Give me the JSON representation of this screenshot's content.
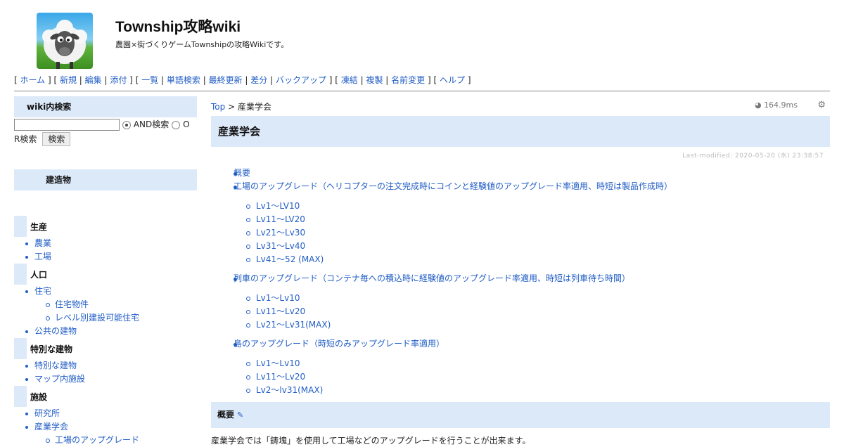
{
  "header": {
    "title": "Township攻略wiki",
    "subtitle": "農園×街づくりゲームTownshipの攻略Wikiです。"
  },
  "toolbar": {
    "groups": [
      [
        "ホーム"
      ],
      [
        "新規",
        "編集",
        "添付"
      ],
      [
        "一覧",
        "単語検索",
        "最終更新",
        "差分",
        "バックアップ"
      ],
      [
        "凍結",
        "複製",
        "名前変更"
      ],
      [
        "ヘルプ"
      ]
    ]
  },
  "sidebar": {
    "search": {
      "heading": "wiki内検索",
      "input_value": "",
      "and_label": "AND検索",
      "or_label_1": "O",
      "or_label_2": "R検索",
      "button_label": "検索"
    },
    "build_heading": "建造物",
    "categories": [
      {
        "name": "生産",
        "items": [
          {
            "label": "農業",
            "level": 1
          },
          {
            "label": "工場",
            "level": 1
          }
        ]
      },
      {
        "name": "人口",
        "items": [
          {
            "label": "住宅",
            "level": 1
          },
          {
            "label": "住宅物件",
            "level": 2
          },
          {
            "label": "レベル別建設可能住宅",
            "level": 2
          },
          {
            "label": "公共の建物",
            "level": 1
          }
        ]
      },
      {
        "name": "特別な建物",
        "items": [
          {
            "label": "特別な建物",
            "level": 1
          },
          {
            "label": "マップ内施設",
            "level": 1
          }
        ]
      },
      {
        "name": "施設",
        "items": [
          {
            "label": "研究所",
            "level": 1
          },
          {
            "label": "産業学会",
            "level": 1
          },
          {
            "label": "工場のアップグレード",
            "level": 2
          }
        ]
      }
    ]
  },
  "main": {
    "breadcrumb_link": "Top",
    "breadcrumb_sep": ">",
    "breadcrumb_current": "産業学会",
    "perf": "164.9ms",
    "page_title": "産業学会",
    "last_modified": "Last-modified: 2020-05-20 (水) 23:38:57",
    "toc": [
      {
        "label": "概要",
        "children": []
      },
      {
        "label": "工場のアップグレード（ヘリコプターの注文完成時にコインと経験値のアップグレード率適用、時短は製品作成時）",
        "children": [
          "Lv1～LV10",
          "Lv11～LV20",
          "Lv21～Lv30",
          "Lv31～Lv40",
          "Lv41～52 (MAX)"
        ]
      },
      {
        "label": "列車のアップグレード（コンテナ毎への積込時に経験値のアップグレード率適用、時短は列車待ち時間）",
        "children": [
          "Lv1～Lv10",
          "Lv11～Lv20",
          "Lv21～Lv31(MAX)"
        ]
      },
      {
        "label": "島のアップグレード（時短のみアップグレード率適用）",
        "children": [
          "Lv1～Lv10",
          "Lv11～Lv20",
          "Lv2～lv31(MAX)"
        ]
      }
    ],
    "section_heading": "概要",
    "body_text": "産業学会では「鋳塊」を使用して工場などのアップグレードを行うことが出来ます。"
  },
  "colors": {
    "accent_bg": "#dce9f9",
    "link": "#215dc6"
  }
}
